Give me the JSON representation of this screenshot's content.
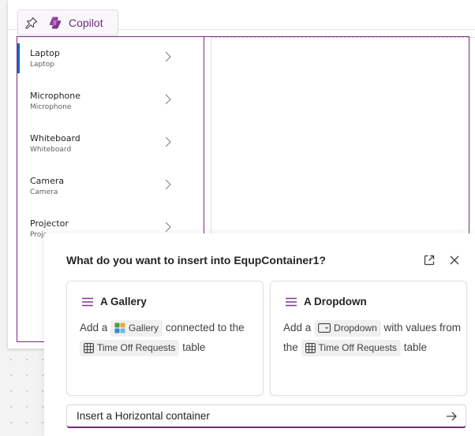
{
  "toolbar": {
    "copilot_label": "Copilot"
  },
  "gallery": {
    "items": [
      {
        "title": "Laptop",
        "subtitle": "Laptop"
      },
      {
        "title": "Microphone",
        "subtitle": "Microphone"
      },
      {
        "title": "Whiteboard",
        "subtitle": "Whiteboard"
      },
      {
        "title": "Camera",
        "subtitle": "Camera"
      },
      {
        "title": "Projector",
        "subtitle": "Projr"
      }
    ]
  },
  "panel": {
    "title": "What do you want to insert into EqupContainer1?",
    "cards": [
      {
        "heading": "A Gallery",
        "text_before": "Add a",
        "chip_control": "Gallery",
        "text_mid": "connected to the",
        "chip_table": "Time Off Requests",
        "text_after": "table"
      },
      {
        "heading": "A Dropdown",
        "text_before": "Add a",
        "chip_control": "Dropdown",
        "text_mid": "with values from the",
        "chip_table": "Time Off Requests",
        "text_after": "table"
      }
    ],
    "input_value": "Insert a Horizontal container"
  },
  "colors": {
    "accent": "#6b2d7e",
    "selection": "#0f6cbd"
  }
}
